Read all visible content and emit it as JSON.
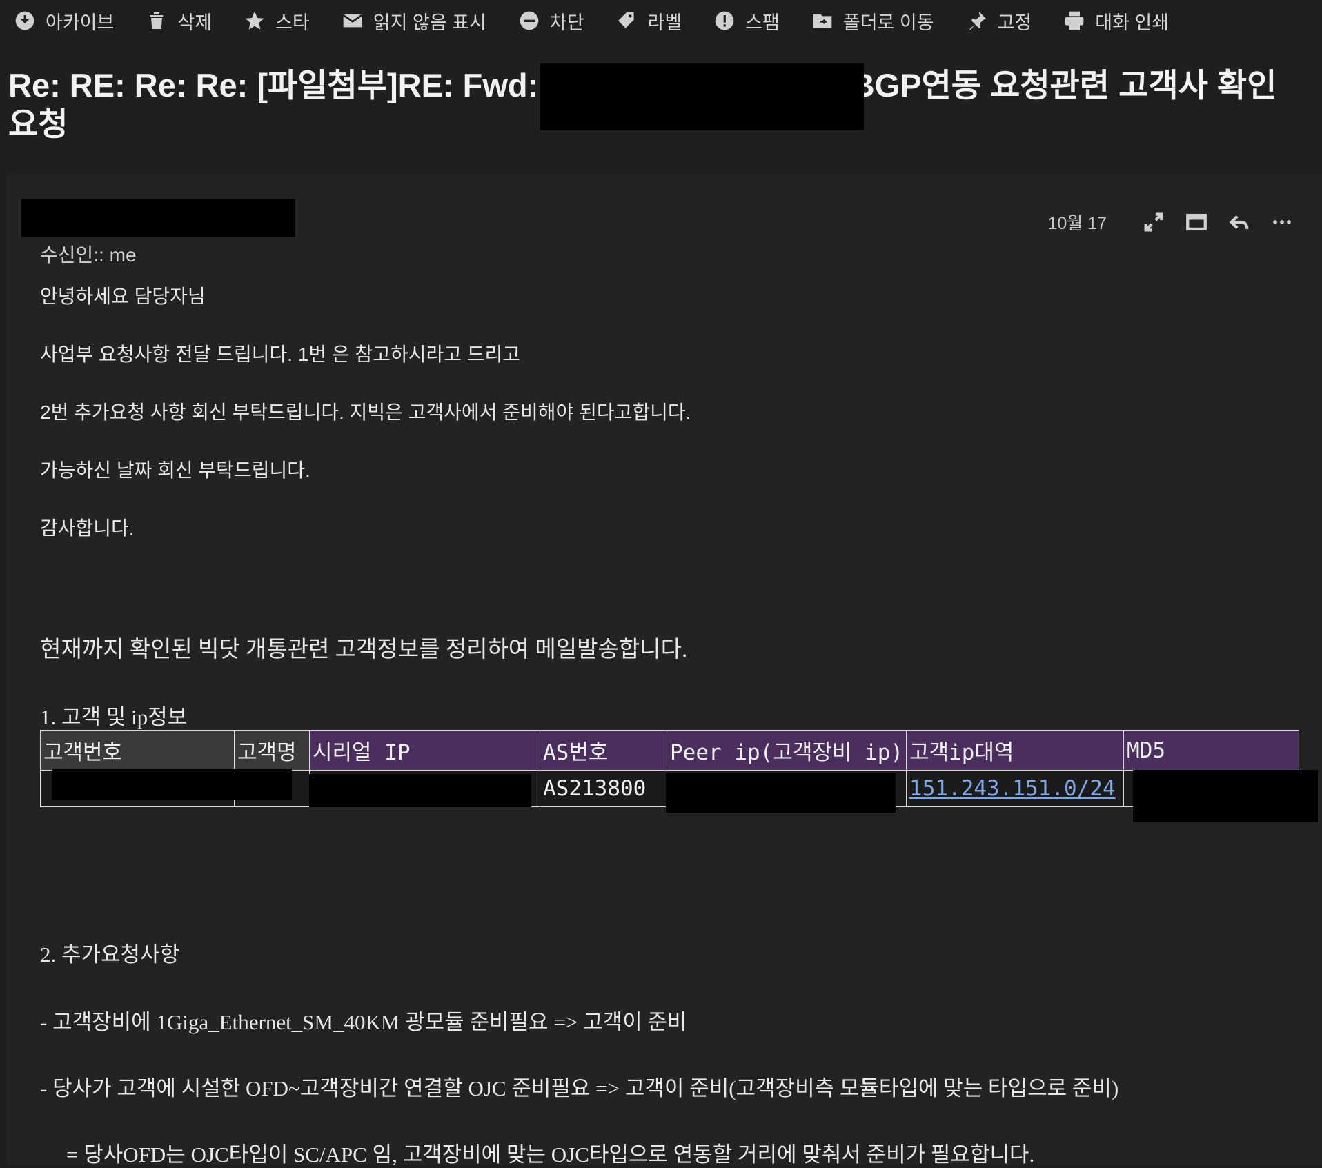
{
  "toolbar": {
    "archive": "아카이브",
    "delete": "삭제",
    "star": "스타",
    "mark_unread": "읽지 않음 표시",
    "block": "차단",
    "label": "라벨",
    "spam": "스팸",
    "move_folder": "폴더로 이동",
    "pin": "고정",
    "print": "대화 인쇄"
  },
  "subject": {
    "part1": "Re: RE: Re: Re: [파일첨부]RE: Fwd: [",
    "part2": "] BGP연동 요청관련 고객사 확인 요청"
  },
  "message": {
    "date": "10월 17",
    "recipient": "수신인:: me",
    "greeting": "안녕하세요 담당자님",
    "line1": "사업부 요청사항 전달 드립니다. 1번 은 참고하시라고 드리고",
    "line2": "2번 추가요청 사항 회신 부탁드립니다. 지빅은 고객사에서 준비해야 된다고합니다.",
    "line3": "가능하신 날짜  회신 부탁드립니다.",
    "thanks": "감사합니다.",
    "intro": "현재까지 확인된 빅닷 개통관련 고객정보를 정리하여 메일발송합니다.",
    "section1": "1. 고객 및 ip정보",
    "section2": "2. 추가요청사항",
    "req1": "- 고객장비에 1Giga_Ethernet_SM_40KM 광모듈 준비필요 => 고객이 준비",
    "req2": "- 당사가 고객에 시설한 OFD~고객장비간 연결할 OJC 준비필요 => 고객이 준비(고객장비측 모듈타입에 맞는 타입으로 준비)",
    "req3": "= 당사OFD는 OJC타입이 SC/APC 임, 고객장비에 맞는 OJC타입으로 연동할 거리에 맞춰서 준비가 필요합니다."
  },
  "table": {
    "headers": [
      "고객번호",
      "고객명",
      "시리얼 IP",
      "AS번호",
      "Peer ip(고객장비 ip)",
      "고객ip대역",
      "MD5"
    ],
    "row": {
      "as_number": "AS213800",
      "ip_range": "151.243.151.0/24"
    }
  }
}
